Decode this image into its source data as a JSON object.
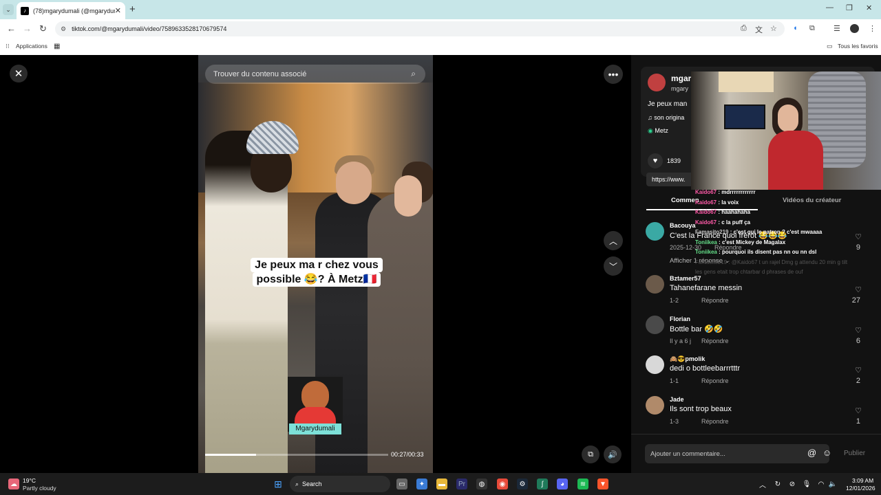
{
  "browser": {
    "tab_title": "(78)mgarydumali (@mgarydumali",
    "url": "tiktok.com/@mgarydumali/video/7589633528170679574",
    "bookmarks": {
      "apps": "Applications",
      "all": "Tous les favoris"
    }
  },
  "video": {
    "search_placeholder": "Trouver du contenu associé",
    "caption_line1": "Je peux ma    r chez vous",
    "caption_line2": "possible 😂? À Metz🇫🇷",
    "sticker_label": "Mgarydumali",
    "time": "00:27/00:33",
    "progress_fraction": 0.28
  },
  "creator": {
    "name": "mgar",
    "handle": "mgary",
    "desc": "Je peux man",
    "music": "son origina",
    "location": "Metz",
    "likes": "1839",
    "link": "https://www."
  },
  "tabs": {
    "comments": "Commen",
    "creator_videos": "Vidéos du créateur"
  },
  "chat": [
    {
      "user": "Kaido67",
      "msg": " : mdrrrrrrrrrrrr",
      "cls": "u"
    },
    {
      "user": "Kaido67",
      "msg": " : la voix",
      "cls": "u"
    },
    {
      "user": "Kaido67",
      "msg": " : haahahaha",
      "cls": "u"
    },
    {
      "user": "Kaido67",
      "msg": " : c la puff ça",
      "cls": "u"
    },
    {
      "user": "Famasito219",
      "msg": " : c'est qui le patron ? c'est mwaaaa",
      "cls": "u3"
    },
    {
      "user": "Toniikea",
      "msg": " : c'est Mickey de Magalax",
      "cls": "u2"
    },
    {
      "user": "Toniikea",
      "msg": " : pourquoi ils disent pas nn ou nn dsl",
      "cls": "u2"
    }
  ],
  "chat_faded": [
    "Famasito219 : @Kaido67 t un rajel Dmg g attendu 20 min g tilt",
    "les gens etait trop chtarbar d phrases de ouf"
  ],
  "comments": [
    {
      "user": "Bacouya",
      "text": "C'est la France quoi frérot 😂😂😂",
      "meta": "2025-12-30",
      "reply": "Répondre",
      "likes": "9"
    },
    {
      "user": "Bztamer57",
      "text": "Tahanefarane messin",
      "meta": "1-2",
      "reply": "Répondre",
      "likes": "27"
    },
    {
      "user": "Florian",
      "text": "Bottle bar 🤣🤣",
      "meta": "Il y a 6 j",
      "reply": "Répondre",
      "likes": "6"
    },
    {
      "user": "🙈😎pmolik",
      "text": "dedi o bottleebarrrtttr",
      "meta": "1-1",
      "reply": "Répondre",
      "likes": "2"
    },
    {
      "user": "Jade",
      "text": "Ils sont trop beaux",
      "meta": "1-3",
      "reply": "Répondre",
      "likes": "1"
    }
  ],
  "more_replies": "Afficher 1 réponse",
  "add_comment": {
    "placeholder": "Ajouter un commentaire...",
    "publish": "Publier"
  },
  "taskbar": {
    "temp": "19°C",
    "weather": "Partly cloudy",
    "search": "Search",
    "time": "3:09 AM",
    "date": "12/01/2026"
  }
}
